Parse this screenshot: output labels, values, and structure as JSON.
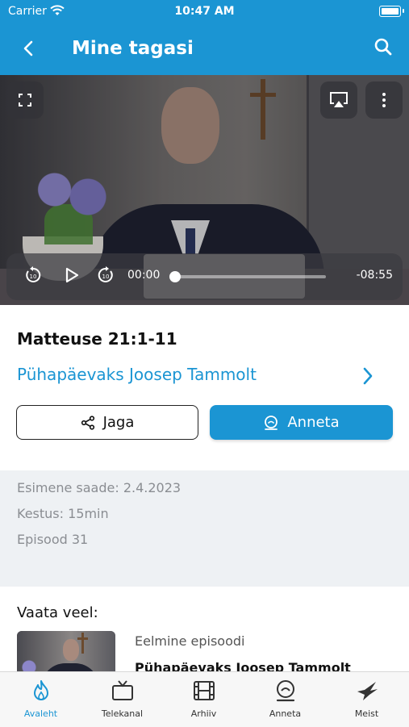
{
  "status_bar": {
    "carrier": "Carrier",
    "time": "10:47 AM"
  },
  "header": {
    "title": "Mine tagasi"
  },
  "player": {
    "current_time": "00:00",
    "remaining_time": "-08:55",
    "progress": 0
  },
  "episode": {
    "title": "Matteuse 21:1-11",
    "series_link": "Pühapäevaks Joosep Tammolt",
    "share_label": "Jaga",
    "donate_label": "Anneta"
  },
  "info": {
    "first_aired": "Esimene saade: 2.4.2023",
    "duration": "Kestus: 15min",
    "episode_no": "Episood 31"
  },
  "more": {
    "heading": "Vaata veel:",
    "prev_label": "Eelmine episoodi",
    "prev_title": "Pühapäevaks Joosep Tammolt"
  },
  "tabbar": {
    "items": [
      {
        "label": "Avaleht",
        "icon": "flame-icon",
        "active": true
      },
      {
        "label": "Telekanal",
        "icon": "tv-icon",
        "active": false
      },
      {
        "label": "Arhiiv",
        "icon": "film-icon",
        "active": false
      },
      {
        "label": "Anneta",
        "icon": "donate-icon",
        "active": false
      },
      {
        "label": "Meist",
        "icon": "dove-icon",
        "active": false
      }
    ]
  },
  "colors": {
    "accent": "#1b95d3"
  }
}
